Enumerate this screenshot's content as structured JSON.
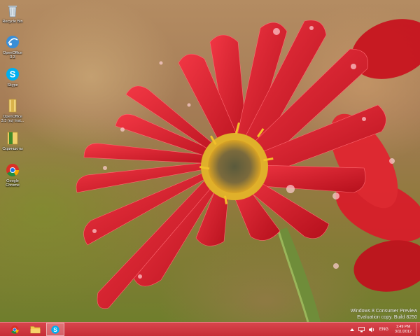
{
  "desktop": {
    "icons": [
      {
        "label": "Recycle Bin",
        "icon": "recycle-bin-icon"
      },
      {
        "label": "OpenOffice 3.3",
        "icon": "openoffice-icon"
      },
      {
        "label": "Skype",
        "icon": "skype-icon"
      },
      {
        "label": "OpenOffice 3.3 (ru) Inst...",
        "icon": "folder-icon"
      },
      {
        "label": "Скриншоты",
        "icon": "folder-icon"
      },
      {
        "label": "Google Chrome",
        "icon": "chrome-icon"
      }
    ]
  },
  "watermark": {
    "line1": "Windows 8 Consumer Preview",
    "line2": "Evaluation copy. Build 8250"
  },
  "taskbar": {
    "apps": [
      {
        "name": "Google Chrome",
        "icon": "chrome-icon"
      },
      {
        "name": "File Explorer",
        "icon": "folder-icon"
      },
      {
        "name": "Skype",
        "icon": "skype-icon"
      }
    ],
    "tray": {
      "language": "ENG",
      "time": "1:49 PM",
      "date": "3/11/2012"
    }
  },
  "colors": {
    "taskbar": "#c62d36",
    "accent_skype": "#00aff0",
    "petal": "#e0202c"
  }
}
